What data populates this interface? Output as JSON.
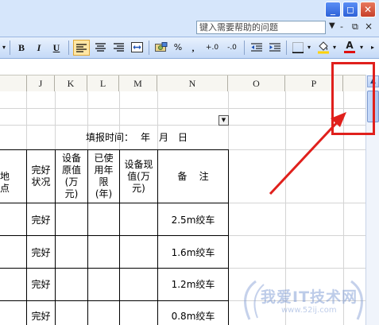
{
  "title_bar": {
    "min": "_",
    "max": "◻",
    "close": "✕"
  },
  "help": {
    "placeholder": "键入需要帮助的问题",
    "dropdown": "▼"
  },
  "mdi": {
    "min": "-",
    "restore": "♬",
    "close": "×"
  },
  "toolbar": {
    "bold": "B",
    "italic": "I",
    "underline": "U",
    "percent": "%",
    "comma": ",",
    "inc_decimal": "+.0",
    "dec_decimal": "-.0",
    "font_color_label": "A",
    "accent_colors": {
      "font_color": "#e01010",
      "fill_color": "#ffd200"
    }
  },
  "columns": [
    "J",
    "K",
    "L",
    "M",
    "N",
    "O",
    "P"
  ],
  "sheet": {
    "fill_time_label": "填报时间：",
    "year": "年",
    "month": "月",
    "day": "日",
    "headers": {
      "location_partial": "地点",
      "status": "完好\n状况",
      "original_value": "设备\n原值\n(万\n元)",
      "years_used": "已使\n用年\n限\n(年)",
      "current_value": "设备现\n值(万\n元)",
      "remarks": "备    注"
    },
    "rows": [
      {
        "status": "完好",
        "remarks": "2.5m绞车"
      },
      {
        "status": "完好",
        "remarks": "1.6m绞车"
      },
      {
        "status": "完好",
        "remarks": "1.2m绞车"
      },
      {
        "status": "完好",
        "remarks": "0.8m绞车"
      }
    ]
  },
  "scrollbar": {
    "up_arrow": "▲"
  },
  "watermark": {
    "text": "我爱IT技术网",
    "url": "www.52ij.com"
  },
  "annotation": {
    "color": "#e0201c"
  }
}
